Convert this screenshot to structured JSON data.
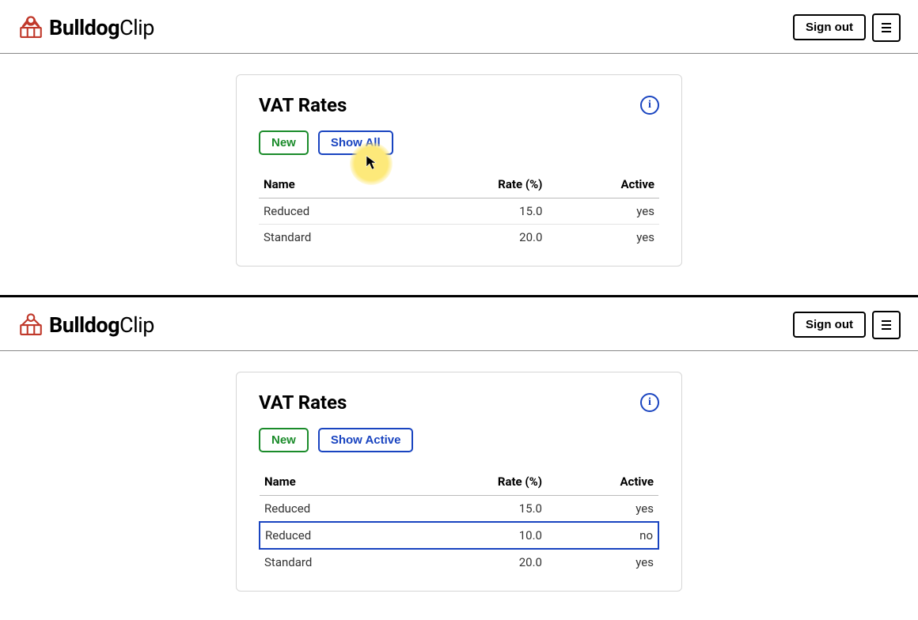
{
  "brand": {
    "strong": "Bulldog",
    "light": "Clip"
  },
  "header": {
    "signout_label": "Sign out"
  },
  "frame_a": {
    "card_title": "VAT Rates",
    "new_label": "New",
    "show_label": "Show All",
    "columns": {
      "name": "Name",
      "rate": "Rate (%)",
      "active": "Active"
    },
    "rows": [
      {
        "name": "Reduced",
        "rate": "15.0",
        "active": "yes"
      },
      {
        "name": "Standard",
        "rate": "20.0",
        "active": "yes"
      }
    ]
  },
  "frame_b": {
    "card_title": "VAT Rates",
    "new_label": "New",
    "show_label": "Show Active",
    "columns": {
      "name": "Name",
      "rate": "Rate (%)",
      "active": "Active"
    },
    "rows": [
      {
        "name": "Reduced",
        "rate": "15.0",
        "active": "yes"
      },
      {
        "name": "Reduced",
        "rate": "10.0",
        "active": "no"
      },
      {
        "name": "Standard",
        "rate": "20.0",
        "active": "yes"
      }
    ],
    "highlight_index": 1
  }
}
